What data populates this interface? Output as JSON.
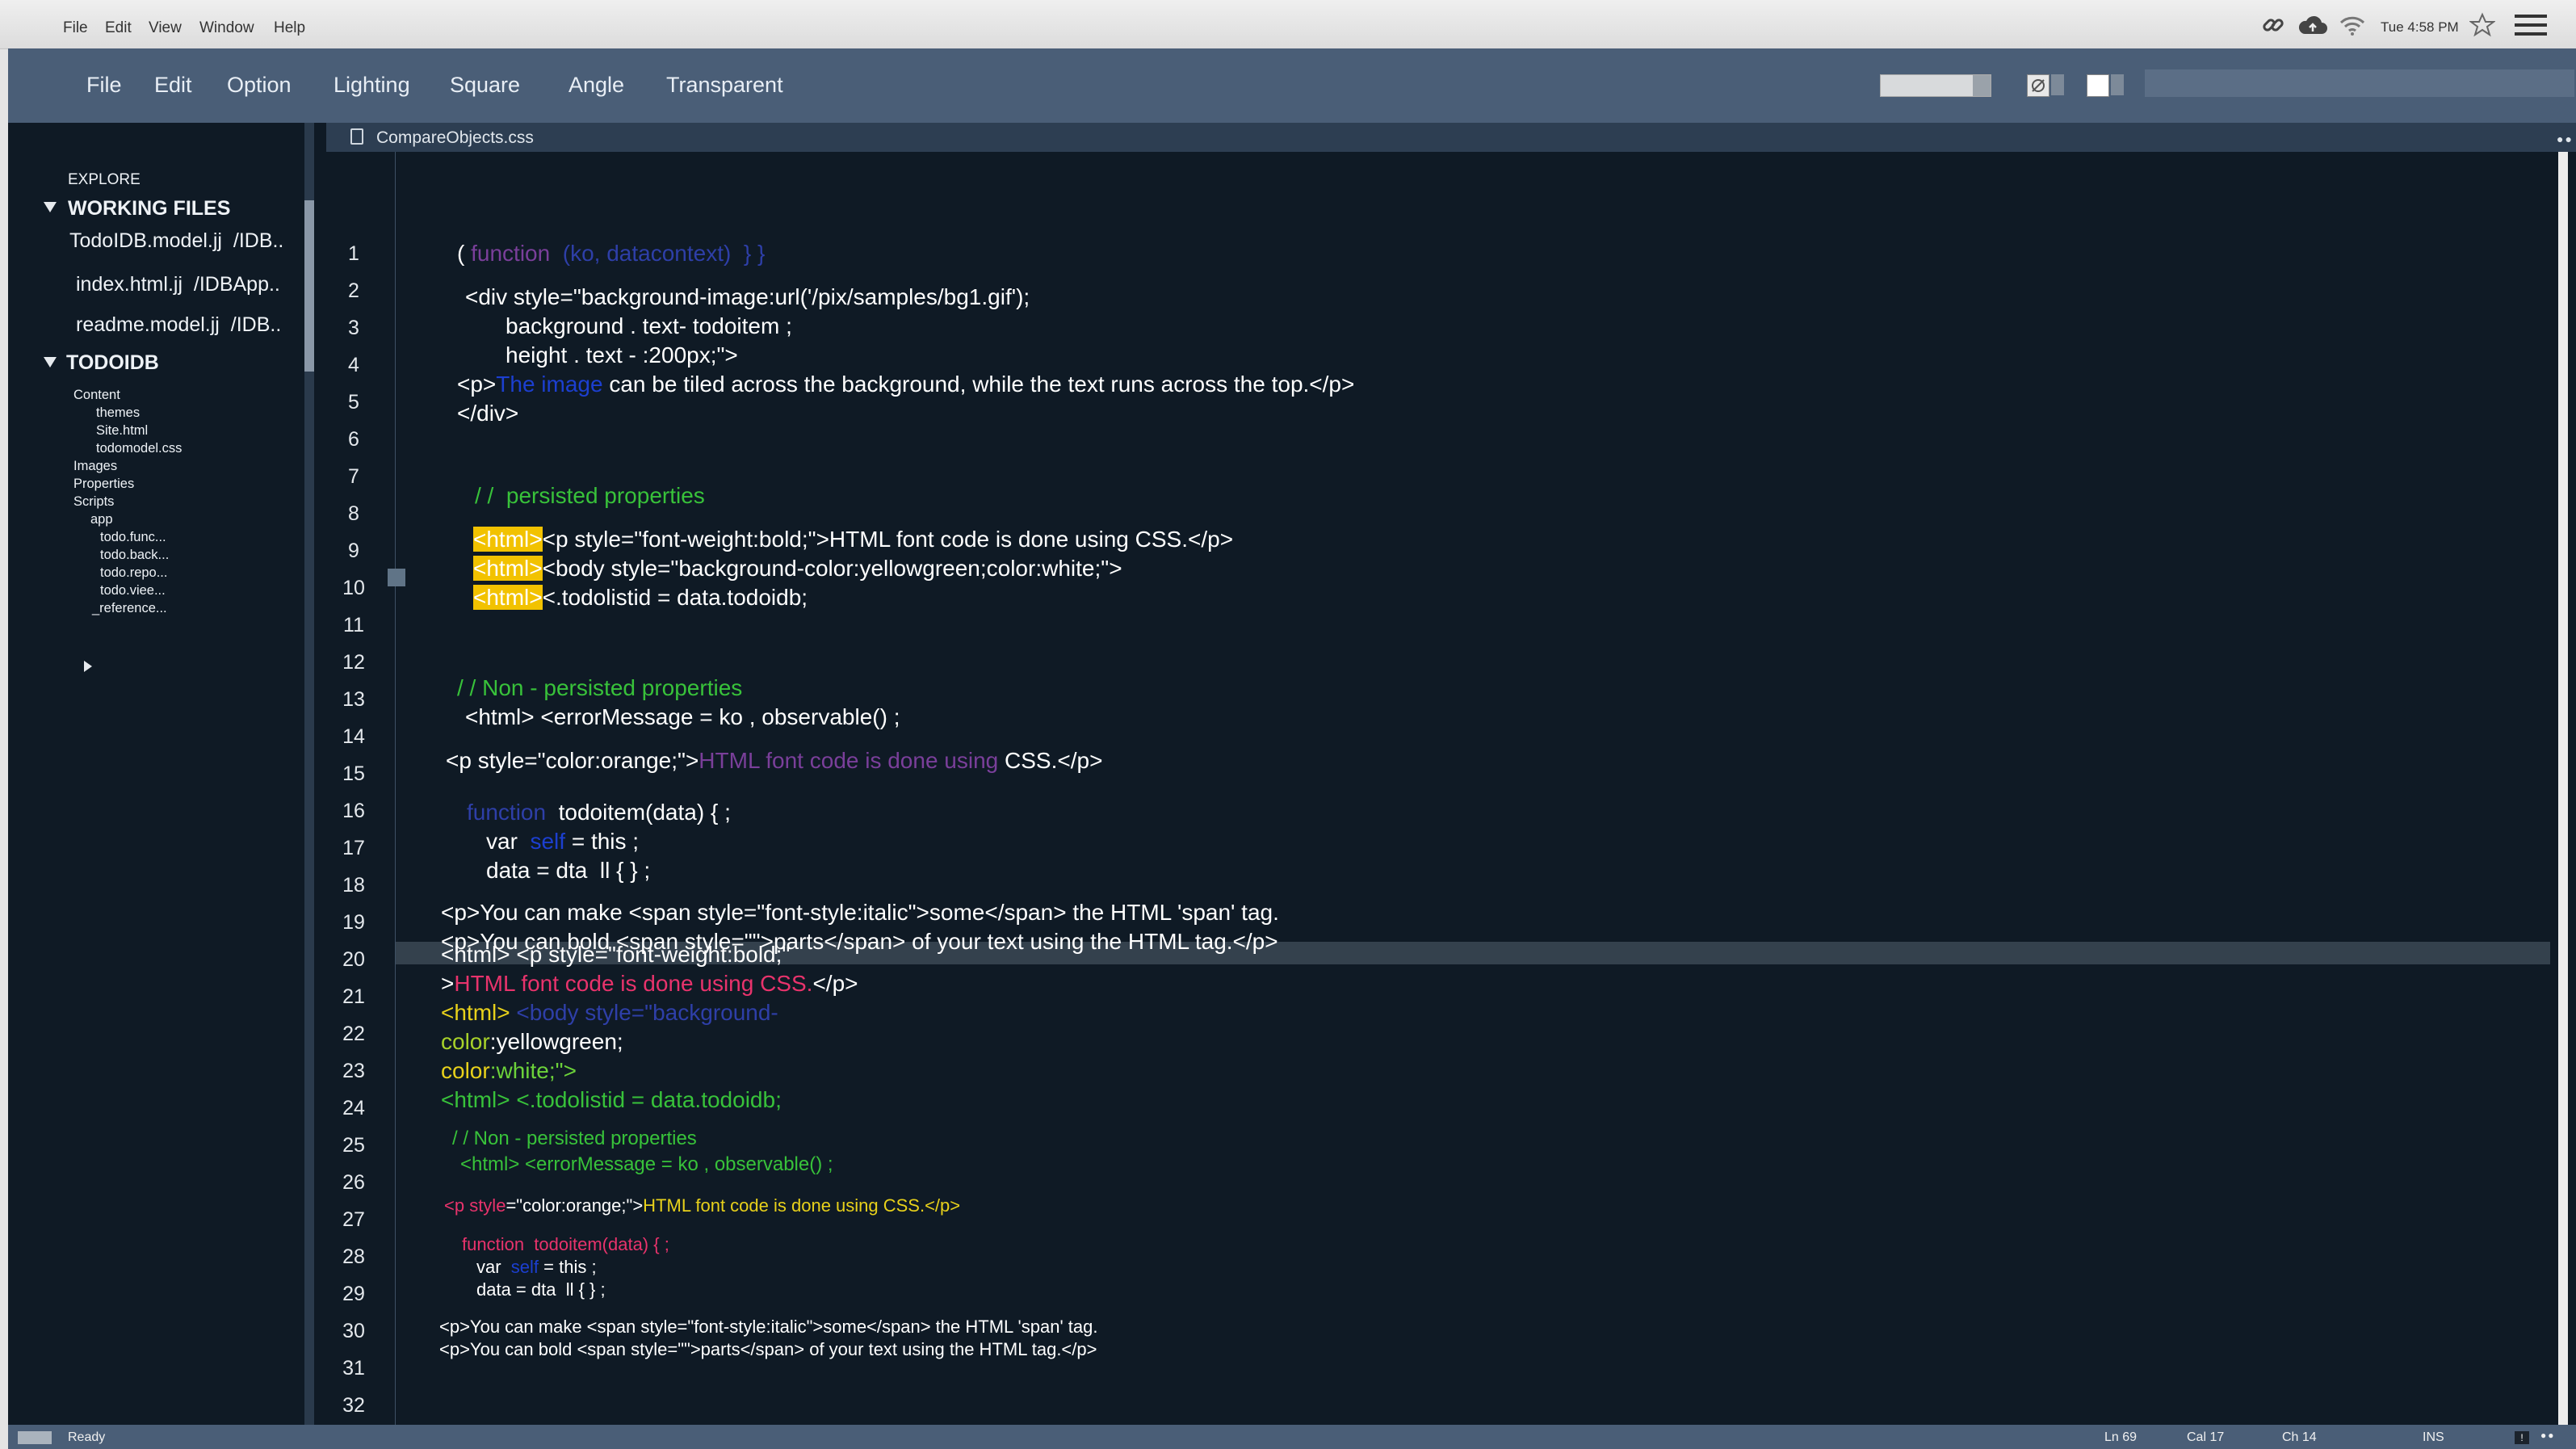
{
  "system_menu": {
    "file": "File",
    "edit": "Edit",
    "view": "View",
    "window": "Window",
    "help": "Help",
    "clock": "Tue 4:58 PM"
  },
  "app_menu": {
    "file": "File",
    "edit": "Edit",
    "option": "Option",
    "lighting": "Lighting",
    "square": "Square",
    "angle": "Angle",
    "transparent": "Transparent"
  },
  "sidebar": {
    "explore": "EXPLORE",
    "working_files": "WORKING FILES",
    "files": [
      "TodoIDB.model.jj  /IDB..",
      "index.html.jj  /IDBApp..",
      "readme.model.jj  /IDB.."
    ],
    "project": "TODOIDB",
    "tree": [
      "Content",
      "themes",
      "Site.html",
      "todomodel.css",
      "Images",
      "Properties",
      "Scripts",
      "app",
      "todo.func...",
      "todo.back...",
      "todo.repo...",
      "todo.viee...",
      "_reference..."
    ]
  },
  "tab": {
    "filename": "CompareObjects.css"
  },
  "code": {
    "l1a": "( ",
    "l1b": "function",
    "l1c": "  (ko, datacontext)  } }",
    "l2": "<div style=\"background-image:url('/pix/samples/bg1.gif');",
    "l3": "background . text- todoitem ;",
    "l4": "height . text - :200px;\">",
    "l5a": "<p>",
    "l5b": "The image",
    "l5c": " can be tiled across the background, while the text runs across the top.</p>",
    "l6": "</div>",
    "l7": "/ /  persisted properties",
    "mark": "<html>",
    "l8": "<p style=\"font-weight:bold;\">HTML font code is done using CSS.</p>",
    "l9": "<body style=\"background-color:yellowgreen;color:white;\">",
    "l10": "<.todolistid = data.todoidb;",
    "l12": "/ / Non - persisted properties",
    "l13": "<html> <errorMessage = ko , observable() ;",
    "l14a": "<p style=\"color:orange;\">",
    "l14b": "HTML font code is done using ",
    "l14c": "CSS.</p>",
    "l15a": "function",
    "l15b": "  todoitem(data) { ;",
    "l16a": "var  ",
    "l16b": "self",
    "l16c": " = this ;",
    "l17": "data = dta  ll { } ;",
    "l18": "<p>You can make <span style=\"font-style:italic\">some</span> the HTML 'span' tag.",
    "l19": "<p>You can bold <span style=\"\">parts</span> of your text using the HTML tag.</p>",
    "l20": "<html> <p style=\"font-weight:bold;\"",
    "l21a": ">",
    "l21b": "HTML font code is done using CSS.",
    "l21c": "</p>",
    "l22a": "<html> ",
    "l22b": "<body style=\"background-",
    "l23a": "color",
    "l23b": ":yellowgreen;",
    "l24a": "color",
    "l24b": ":white;\">",
    "l25": "<html> <.todolistid = data.todoidb;",
    "l26": "/ / Non - persisted properties",
    "l27": "<html> <errorMessage = ko , observable() ;",
    "l28a": "<p style",
    "l28b": "=\"color:orange;\">",
    "l28c": "HTML font code is done using CSS.</p>",
    "l29": "function  todoitem(data) { ;",
    "l30a": "var  ",
    "l30b": "self",
    "l30c": " = this ;",
    "l31": "data = dta  ll { } ;",
    "l32": "<p>You can make <span style=\"font-style:italic\">some</span> the HTML 'span' tag.",
    "l33": "<p>You can bold <span style=\"\">parts</span> of your text using the HTML tag.</p>"
  },
  "line_numbers": [
    "1",
    "2",
    "3",
    "4",
    "5",
    "6",
    "7",
    "8",
    "9",
    "10",
    "11",
    "12",
    "13",
    "14",
    "15",
    "16",
    "17",
    "18",
    "19",
    "20",
    "21",
    "22",
    "23",
    "24",
    "25",
    "26",
    "27",
    "28",
    "29",
    "30",
    "31",
    "32"
  ],
  "status": {
    "ready": "Ready",
    "ln": "Ln 69",
    "col": "Cal 17",
    "ch": "Ch 14",
    "mode": "INS"
  },
  "colors": {
    "toolbar": "#4a5e77",
    "editor_bg": "#0f1a25",
    "keyword_purple": "#7a3f9a",
    "keyword_blue": "#1c3fd0",
    "comment_green": "#38c23a",
    "mark_yellow": "#f2c200",
    "pink": "#e8336c",
    "yellow": "#e8d11b"
  }
}
